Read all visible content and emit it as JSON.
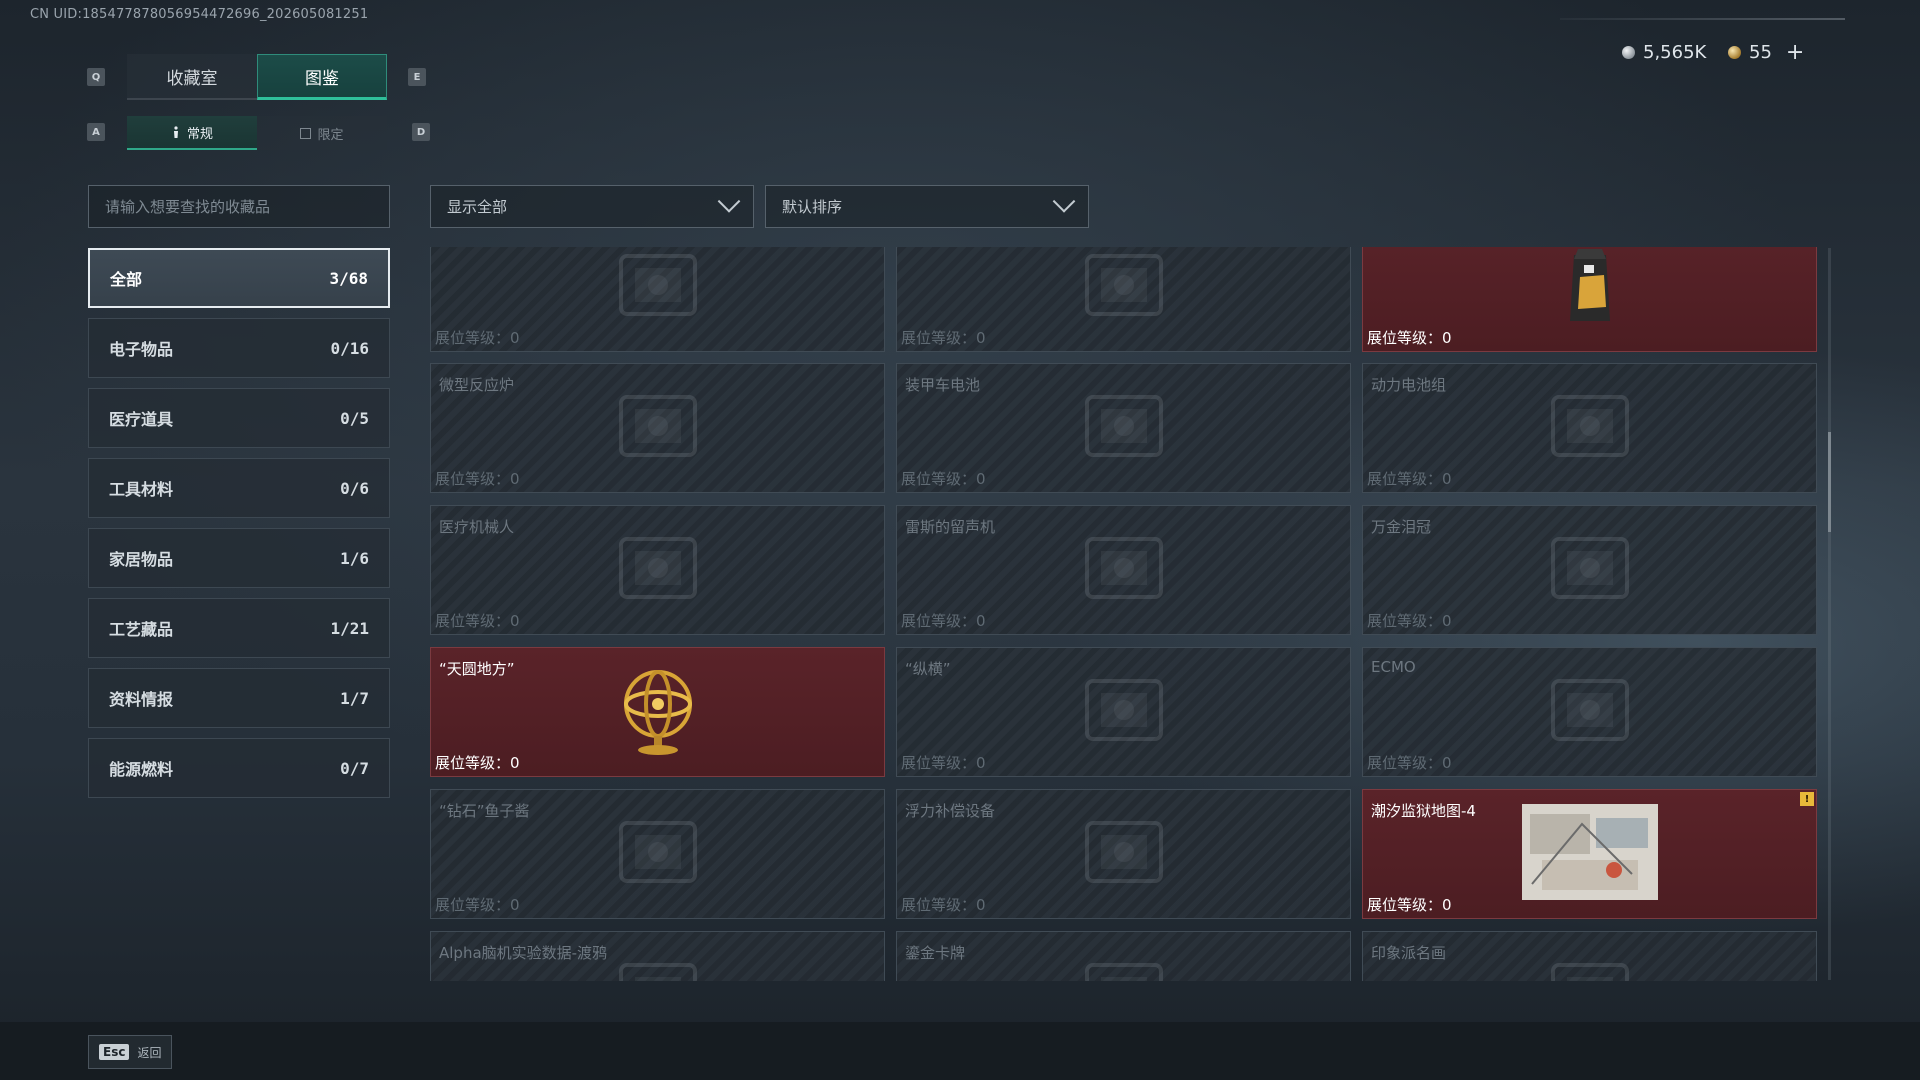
{
  "header": {
    "uid": "CN UID:18547787805695447269​6_202605081251"
  },
  "currency": {
    "silver_value": "5,565K",
    "gold_value": "55",
    "plus_label": "+"
  },
  "key_hints": {
    "left_tab": "Q",
    "right_tab": "E",
    "left_sub": "A",
    "right_sub": "D"
  },
  "tabs": [
    {
      "label": "收藏室",
      "active": false
    },
    {
      "label": "图鉴",
      "active": true
    }
  ],
  "subtabs": [
    {
      "label": "常规",
      "active": true
    },
    {
      "label": "限定",
      "active": false
    }
  ],
  "search": {
    "placeholder": "请输入想要查找的收藏品"
  },
  "filters": {
    "show_label": "显示全部",
    "sort_label": "默认排序"
  },
  "categories": [
    {
      "label": "全部",
      "count": "3/68",
      "active": true
    },
    {
      "label": "电子物品",
      "count": "0/16",
      "active": false
    },
    {
      "label": "医疗道具",
      "count": "0/5",
      "active": false
    },
    {
      "label": "工具材料",
      "count": "0/6",
      "active": false
    },
    {
      "label": "家居物品",
      "count": "1/6",
      "active": false
    },
    {
      "label": "工艺藏品",
      "count": "1/21",
      "active": false
    },
    {
      "label": "资料情报",
      "count": "1/7",
      "active": false
    },
    {
      "label": "能源燃料",
      "count": "0/7",
      "active": false
    }
  ],
  "level_label": "展位等级：0",
  "items": [
    {
      "name": "",
      "owned": false,
      "icon": "safe-box-icon"
    },
    {
      "name": "",
      "owned": false,
      "icon": "machine-icon"
    },
    {
      "name": "",
      "owned": true,
      "icon": "coffee-bag-icon"
    },
    {
      "name": "微型反应炉",
      "owned": false,
      "icon": "reactor-icon"
    },
    {
      "name": "装甲车电池",
      "owned": false,
      "icon": "battery-icon"
    },
    {
      "name": "动力电池组",
      "owned": false,
      "icon": "battery-pack-icon"
    },
    {
      "name": "医疗机械人",
      "owned": false,
      "icon": "medical-robot-icon"
    },
    {
      "name": "雷斯的留声机",
      "owned": false,
      "icon": "gramophone-icon"
    },
    {
      "name": "万金泪冠",
      "owned": false,
      "icon": "crown-icon"
    },
    {
      "name": "“天圆地方”",
      "owned": true,
      "icon": "armillary-sphere-icon"
    },
    {
      "name": "“纵横”",
      "owned": false,
      "icon": "chessboard-icon"
    },
    {
      "name": "ECMO",
      "owned": false,
      "icon": "ecmo-icon"
    },
    {
      "name": "“钻石”鱼子酱",
      "owned": false,
      "icon": "caviar-tin-icon"
    },
    {
      "name": "浮力补偿设备",
      "owned": false,
      "icon": "buoyancy-device-icon"
    },
    {
      "name": "潮汐监狱地图-4",
      "owned": true,
      "icon": "prison-map-icon",
      "badge": "!"
    },
    {
      "name": "Alpha脑机实验数据-渡鸦",
      "owned": false,
      "icon": "data-icon"
    },
    {
      "name": "鎏金卡牌",
      "owned": false,
      "icon": "card-icon"
    },
    {
      "name": "印象派名画",
      "owned": false,
      "icon": "painting-icon"
    }
  ],
  "footer": {
    "esc_key": "Esc",
    "back_label": "返回"
  },
  "colors": {
    "accent_teal": "#2fbf9a",
    "owned_red": "#5a2329",
    "badge_yellow": "#e8b93a"
  }
}
